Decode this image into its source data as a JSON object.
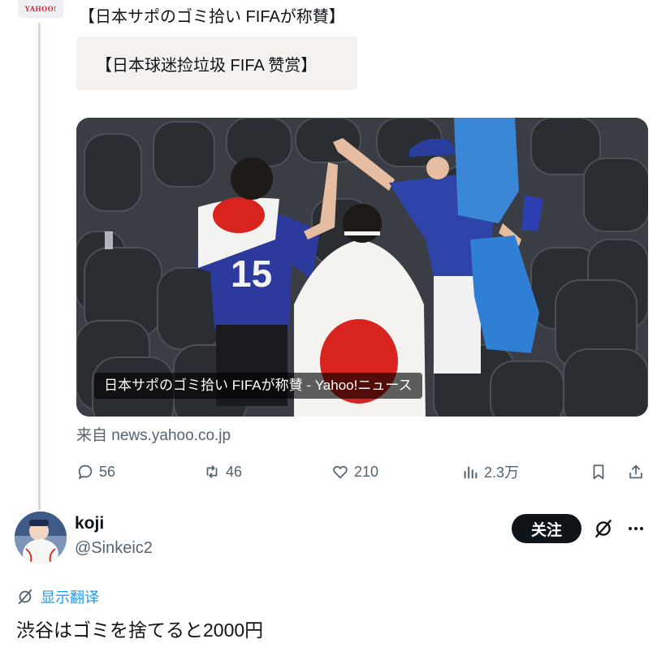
{
  "post": {
    "logo_text": "YAHOO!",
    "title": "【日本サポのゴミ拾い FIFAが称賛】",
    "translation": "【日本球迷捡垃圾 FIFA 赞赏】",
    "card": {
      "caption": "日本サポのゴミ拾い FIFAが称賛 - Yahoo!ニュース",
      "jersey_number": "15"
    },
    "source": "来自 news.yahoo.co.jp",
    "actions": {
      "replies": "56",
      "reposts": "46",
      "likes": "210",
      "views": "2.3万"
    }
  },
  "reply": {
    "name": "koji",
    "handle": "@Sinkeic2",
    "follow_label": "关注",
    "translate_label": "显示翻译",
    "text": "渋谷はゴミを捨てると2000円"
  },
  "colors": {
    "secondary_text": "#536471",
    "link_blue": "#1d9bf0",
    "dark_button": "#0f1419",
    "jersey_blue": "#2b3a9c",
    "flag_red": "#d8231f"
  }
}
